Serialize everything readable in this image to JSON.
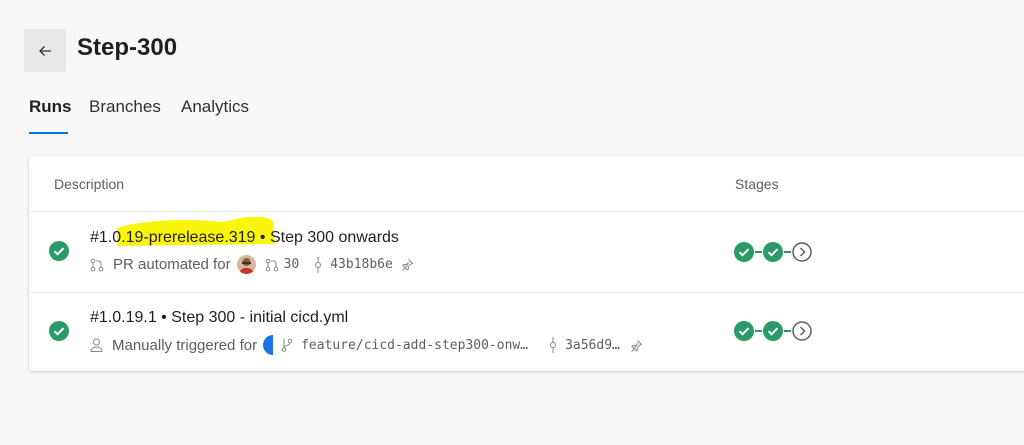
{
  "header": {
    "title": "Step-300",
    "back_icon": "arrow-left-icon"
  },
  "tabs": [
    {
      "label": "Runs",
      "active": true
    },
    {
      "label": "Branches",
      "active": false
    },
    {
      "label": "Analytics",
      "active": false
    }
  ],
  "table": {
    "columns": {
      "description": "Description",
      "stages": "Stages"
    },
    "rows": [
      {
        "status": "succeeded",
        "run_number": "#1.0.19-prerelease.319",
        "separator": " • ",
        "name": "Step 300 onwards",
        "trigger": "PR automated for",
        "pr_number": "30",
        "commit": "43b18b6e",
        "stages": [
          "succeeded",
          "succeeded",
          "pending"
        ]
      },
      {
        "status": "succeeded",
        "run_number": "#1.0.19.1",
        "separator": " • ",
        "name": "Step 300 - initial cicd.yml",
        "trigger": "Manually triggered for",
        "branch": "feature/cicd-add-step300-onw…",
        "commit": "3a56d9…",
        "stages": [
          "succeeded",
          "succeeded",
          "pending"
        ]
      }
    ]
  },
  "colors": {
    "accent": "#0078d4",
    "success": "#2b9a66",
    "highlight": "#f9f50b"
  }
}
